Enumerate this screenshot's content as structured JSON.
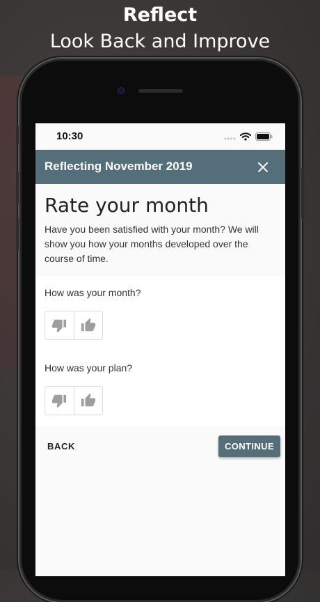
{
  "promo": {
    "title": "Reflect",
    "subtitle": "Look Back and Improve"
  },
  "status_bar": {
    "time": "10:30"
  },
  "app_bar": {
    "title": "Reflecting November 2019"
  },
  "header": {
    "title": "Rate your month",
    "description": "Have you been satisfied with your month? We will show you how your months developed over the course of time."
  },
  "questions": [
    {
      "label": "How was your month?"
    },
    {
      "label": "How was your plan?"
    }
  ],
  "footer": {
    "back_label": "BACK",
    "continue_label": "CONTINUE"
  },
  "colors": {
    "primary": "#546e7a",
    "icon_gray": "#9e9e9e"
  }
}
